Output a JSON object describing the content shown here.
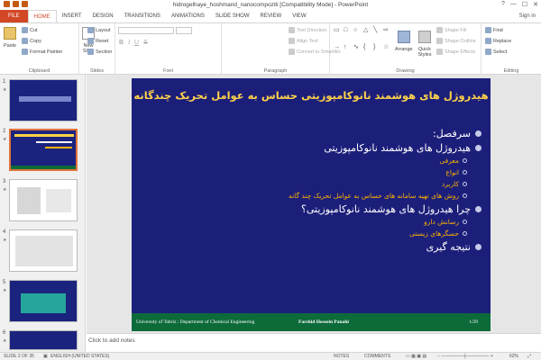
{
  "window": {
    "title": "hidrogelhaye_hoshmand_nanocompoziti [Compatibility Mode] - PowerPoint",
    "controls": [
      "?",
      "—",
      "☐",
      "✕"
    ]
  },
  "tabs": [
    "FILE",
    "HOME",
    "INSERT",
    "DESIGN",
    "TRANSITIONS",
    "ANIMATIONS",
    "SLIDE SHOW",
    "REVIEW",
    "VIEW"
  ],
  "active_tab": "HOME",
  "user": "Sign in",
  "ribbon": {
    "clipboard": {
      "label": "Clipboard",
      "paste": "Paste",
      "cut": "Cut",
      "copy": "Copy",
      "format_painter": "Format Painter"
    },
    "slides": {
      "label": "Slides",
      "new_slide": "New Slide",
      "layout": "Layout",
      "reset": "Reset",
      "section": "Section"
    },
    "font": {
      "label": "Font"
    },
    "paragraph": {
      "label": "Paragraph",
      "text_direction": "Text Direction",
      "align_text": "Align Text",
      "convert": "Convert to SmartArt"
    },
    "drawing": {
      "label": "Drawing",
      "arrange": "Arrange",
      "quick_styles": "Quick Styles",
      "shape_fill": "Shape Fill",
      "shape_outline": "Shape Outline",
      "shape_effects": "Shape Effects"
    },
    "editing": {
      "label": "Editing",
      "find": "Find",
      "replace": "Replace",
      "select": "Select"
    }
  },
  "thumbnails": [
    {
      "num": "1",
      "star": "★"
    },
    {
      "num": "2",
      "star": "★"
    },
    {
      "num": "3",
      "star": "★"
    },
    {
      "num": "4",
      "star": "★"
    },
    {
      "num": "5",
      "star": "★"
    },
    {
      "num": "6",
      "star": "★"
    }
  ],
  "slide": {
    "title": "هیدروژل های هوشمند نانوکامپوزیتی حساس به عوامل تحریک چندگانه",
    "level1": [
      "سرفصل:",
      "هیدروژل های هوشمند نانوکامپوزیتی",
      "چرا هیدروژل های هوشمند نانوکامپوزیتی؟",
      "نتیجه گیری"
    ],
    "sub1": [
      "معرفی",
      "انواع",
      "کاربرد",
      "روش های تهیه سامانه های حساس به عوامل تحریک چند گانه"
    ],
    "sub2": [
      "رسانش دارو",
      "حسگرهای زیستی"
    ],
    "footer_left": "University of Tabriz : Department of Chemical Engineering",
    "footer_mid": "Farshid Hossein Panahi",
    "footer_right": "1/29"
  },
  "notes_placeholder": "Click to add notes",
  "status": {
    "slide": "SLIDE 2 OF 35",
    "language": "ENGLISH (UNITED STATES)",
    "notes": "NOTES",
    "comments": "COMMENTS",
    "zoom": "62%"
  }
}
